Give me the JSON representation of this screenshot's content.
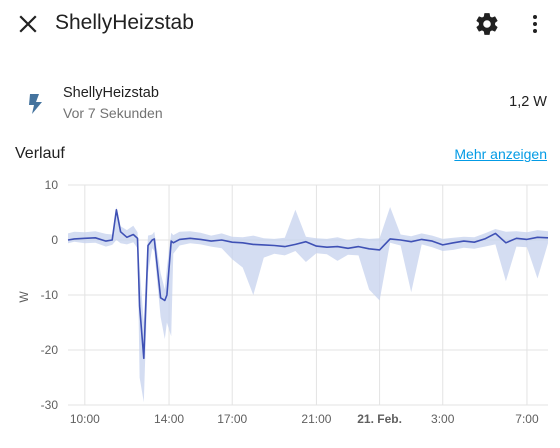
{
  "header": {
    "title": "ShellyHeizstab"
  },
  "entity": {
    "name": "ShellyHeizstab",
    "last_changed": "Vor 7 Sekunden",
    "state": "1,2 W"
  },
  "history": {
    "title": "Verlauf",
    "more_link": "Mehr anzeigen"
  },
  "colors": {
    "line": "#3f51b5",
    "band": "#c5d2ee",
    "icon": "#44739e",
    "link": "#039be5",
    "grid": "#e3e3e3"
  },
  "chart_data": {
    "type": "line",
    "ylabel": "W",
    "ylim": [
      -30,
      10
    ],
    "yticks": [
      10,
      0,
      -10,
      -20,
      -30
    ],
    "xlim": [
      9.2,
      32.0
    ],
    "xticks": [
      {
        "x": 10,
        "label": "10:00",
        "bold": false
      },
      {
        "x": 14,
        "label": "14:00",
        "bold": false
      },
      {
        "x": 17,
        "label": "17:00",
        "bold": false
      },
      {
        "x": 21,
        "label": "21:00",
        "bold": false
      },
      {
        "x": 24,
        "label": "21. Feb.",
        "bold": true
      },
      {
        "x": 27,
        "label": "3:00",
        "bold": false
      },
      {
        "x": 31,
        "label": "7:00",
        "bold": false
      }
    ],
    "grid": true,
    "series": [
      {
        "x": [
          9.2,
          9.5,
          10.0,
          10.5,
          11.0,
          11.3,
          11.5,
          11.7,
          12.0,
          12.3,
          12.5,
          12.6,
          12.8,
          13.0,
          13.2,
          13.3,
          13.6,
          13.8,
          13.9,
          14.1,
          14.2,
          14.5,
          15.0,
          15.5,
          16.0,
          16.5,
          17.0,
          17.5,
          18.0,
          18.5,
          19.0,
          19.5,
          20.0,
          20.5,
          21.0,
          21.5,
          22.0,
          22.5,
          23.0,
          23.5,
          24.0,
          24.5,
          25.0,
          25.5,
          26.0,
          26.5,
          27.0,
          27.5,
          28.0,
          28.5,
          29.0,
          29.5,
          30.0,
          30.5,
          31.0,
          31.5,
          32.0
        ],
        "y": [
          0.0,
          0.2,
          0.3,
          0.4,
          -0.2,
          0.0,
          5.5,
          1.5,
          0.5,
          1.0,
          0.3,
          -12.0,
          -21.5,
          -1.0,
          0.0,
          0.2,
          -10.5,
          -11.0,
          -10.0,
          -0.2,
          -0.5,
          0.1,
          0.3,
          0.1,
          -0.2,
          0.0,
          -0.4,
          -0.5,
          -0.8,
          -0.9,
          -1.0,
          -1.2,
          -0.8,
          -0.3,
          -1.1,
          -1.3,
          -1.2,
          -1.5,
          -1.2,
          -1.6,
          -1.8,
          0.2,
          0.0,
          -0.3,
          0.1,
          -0.2,
          -0.9,
          -0.5,
          -0.2,
          -0.4,
          0.2,
          1.2,
          -0.5,
          0.3,
          0.1,
          0.5,
          0.4
        ],
        "y_min": [
          -0.6,
          -0.3,
          -0.6,
          -0.5,
          -1.2,
          -0.9,
          0.0,
          -0.6,
          -0.8,
          -0.4,
          -1.5,
          -25.0,
          -29.5,
          -6.0,
          -1.5,
          -2.0,
          -14.0,
          -18.0,
          -15.0,
          -17.5,
          -2.5,
          -1.0,
          -0.6,
          -0.8,
          -1.2,
          -1.5,
          -3.5,
          -5.0,
          -10.0,
          -3.2,
          -2.5,
          -2.8,
          -2.0,
          -4.0,
          -2.4,
          -2.6,
          -3.8,
          -2.7,
          -2.8,
          -9.0,
          -11.0,
          -0.5,
          -1.0,
          -9.5,
          -0.8,
          -1.3,
          -2.0,
          -1.8,
          -1.4,
          -1.6,
          -1.2,
          -0.8,
          -7.5,
          -1.2,
          -1.3,
          -7.0,
          -0.6
        ],
        "y_max": [
          1.2,
          1.5,
          1.4,
          1.6,
          1.1,
          1.0,
          6.0,
          2.5,
          1.8,
          2.6,
          1.4,
          -5.0,
          -15.0,
          0.8,
          1.0,
          1.5,
          -6.0,
          -9.0,
          -5.0,
          1.3,
          0.9,
          1.5,
          1.6,
          1.3,
          0.8,
          1.2,
          0.6,
          0.5,
          0.8,
          0.3,
          0.2,
          0.4,
          5.5,
          0.6,
          0.3,
          0.2,
          0.5,
          0.0,
          0.4,
          0.2,
          0.3,
          6.0,
          1.0,
          0.7,
          1.2,
          0.8,
          0.2,
          0.4,
          0.6,
          0.5,
          1.2,
          2.0,
          1.5,
          1.6,
          1.4,
          1.8,
          1.6
        ]
      }
    ]
  }
}
